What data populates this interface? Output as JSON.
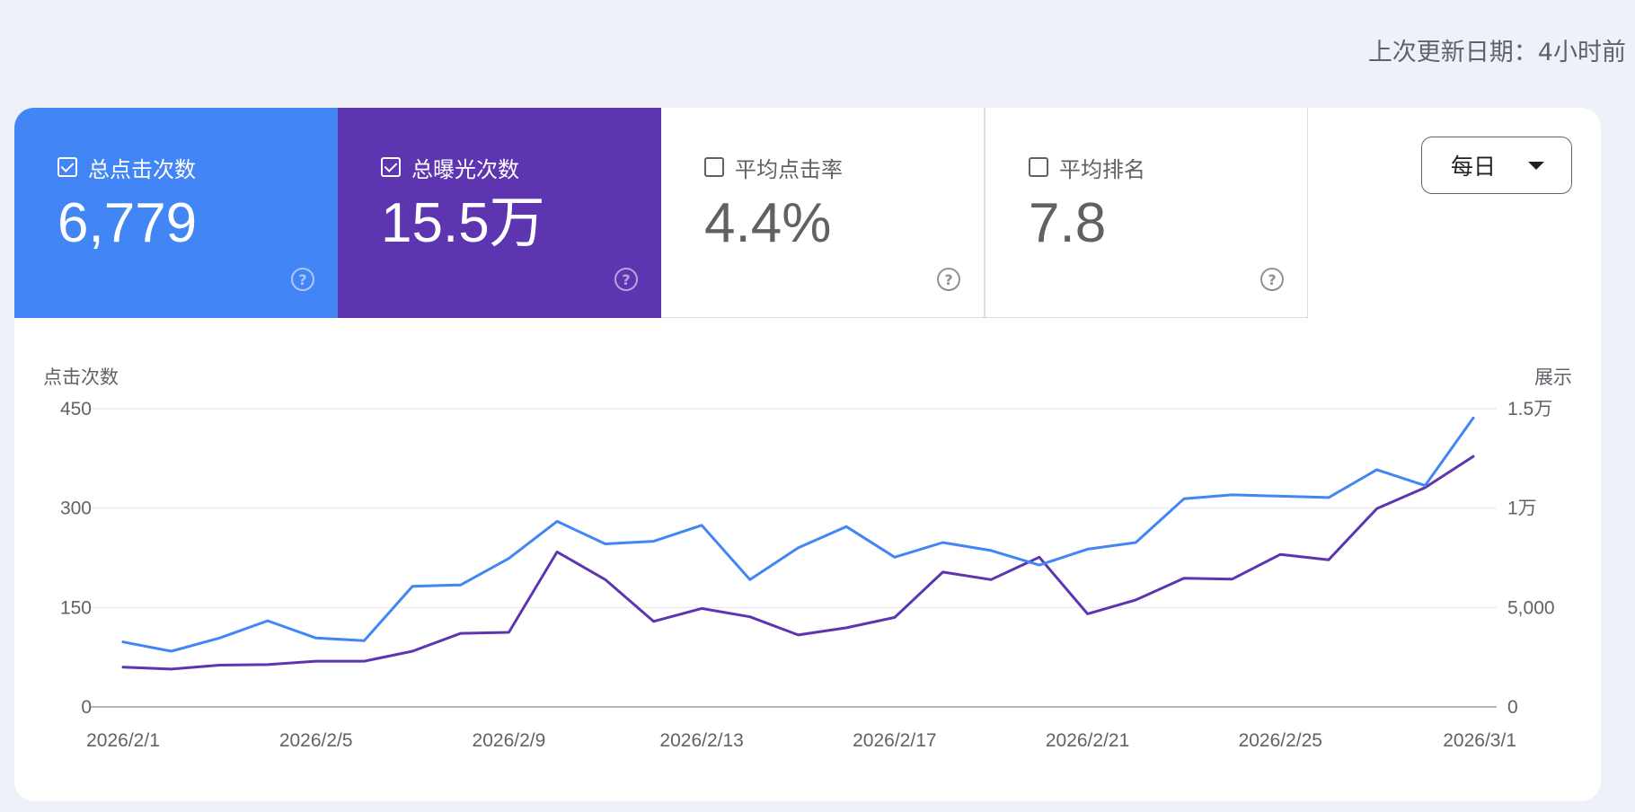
{
  "header": {
    "last_updated": "上次更新日期：4小时前"
  },
  "metrics": [
    {
      "label": "总点击次数",
      "value": "6,779",
      "checked": true,
      "color": "#4285f4"
    },
    {
      "label": "总曝光次数",
      "value": "15.5万",
      "checked": true,
      "color": "#5e35b1"
    },
    {
      "label": "平均点击率",
      "value": "4.4%",
      "checked": false
    },
    {
      "label": "平均排名",
      "value": "7.8",
      "checked": false
    }
  ],
  "help_icon": "help-circle-icon",
  "granularity": {
    "selected": "每日"
  },
  "chart_data": {
    "type": "line",
    "x": [
      "2026/2/1",
      "2026/2/2",
      "2026/2/3",
      "2026/2/4",
      "2026/2/5",
      "2026/2/6",
      "2026/2/7",
      "2026/2/8",
      "2026/2/9",
      "2026/2/10",
      "2026/2/11",
      "2026/2/12",
      "2026/2/13",
      "2026/2/14",
      "2026/2/15",
      "2026/2/16",
      "2026/2/17",
      "2026/2/18",
      "2026/2/19",
      "2026/2/20",
      "2026/2/21",
      "2026/2/22",
      "2026/2/23",
      "2026/2/24",
      "2026/2/25",
      "2026/2/26",
      "2026/2/27",
      "2026/2/28",
      "2026/3/1"
    ],
    "x_tick_labels": [
      "2026/2/1",
      "2026/2/5",
      "2026/2/9",
      "2026/2/13",
      "2026/2/17",
      "2026/2/21",
      "2026/2/25",
      "2026/3/1"
    ],
    "ylabel_left": "点击次数",
    "ylabel_right": "展示",
    "ylim_left": [
      0,
      450
    ],
    "ylim_right": [
      0,
      15000
    ],
    "yticks_left": [
      "0",
      "150",
      "300",
      "450"
    ],
    "yticks_right": [
      "0",
      "5,000",
      "1万",
      "1.5万"
    ],
    "grid": true,
    "series": [
      {
        "name": "总点击次数",
        "axis": "left",
        "color": "#4285f4",
        "values": [
          98,
          84,
          104,
          130,
          104,
          100,
          182,
          184,
          224,
          280,
          246,
          250,
          274,
          192,
          240,
          272,
          226,
          248,
          236,
          214,
          238,
          248,
          314,
          320,
          318,
          316,
          358,
          334,
          436
        ]
      },
      {
        "name": "总曝光次数",
        "axis": "right",
        "color": "#5e35b1",
        "values": [
          2000,
          1900,
          2100,
          2130,
          2300,
          2300,
          2800,
          3700,
          3750,
          7800,
          6400,
          4300,
          4950,
          4530,
          3620,
          3980,
          4500,
          6780,
          6400,
          7530,
          4680,
          5380,
          6470,
          6430,
          7670,
          7400,
          9970,
          11030,
          12600
        ]
      }
    ]
  }
}
